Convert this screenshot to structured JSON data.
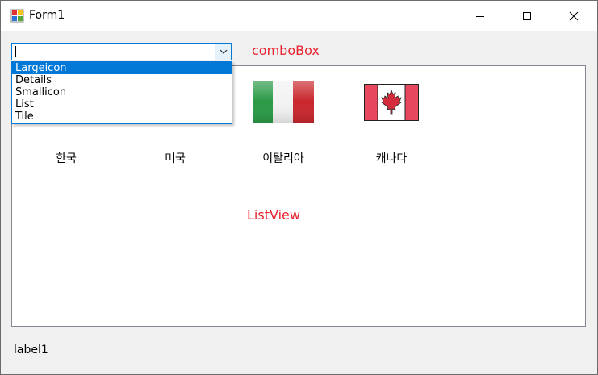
{
  "window": {
    "title": "Form1"
  },
  "combobox": {
    "value": "",
    "annotation": "comboBox",
    "options": [
      "Largeicon",
      "Details",
      "Smallicon",
      "List",
      "Tile"
    ],
    "selected_index": 0
  },
  "listview": {
    "annotation": "ListView",
    "items": [
      {
        "label": "한국",
        "icon": "korea-flag-icon"
      },
      {
        "label": "미국",
        "icon": "usa-flag-icon"
      },
      {
        "label": "이탈리아",
        "icon": "italy-flag-icon"
      },
      {
        "label": "캐나다",
        "icon": "canada-flag-icon"
      }
    ]
  },
  "status_label": "label1",
  "colors": {
    "accent": "#0078d7",
    "annotation": "#e8232f"
  }
}
